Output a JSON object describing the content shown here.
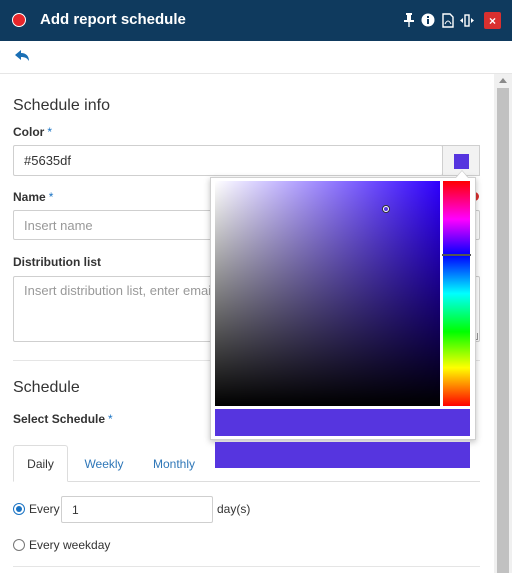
{
  "window": {
    "title": "Add report schedule",
    "icons": [
      "pin-icon",
      "info-icon",
      "pdf-icon",
      "resize-icon"
    ],
    "close_label": "×"
  },
  "colors": {
    "accent": "#5635df",
    "header_bg": "#0f3a5e",
    "link": "#2f77b8"
  },
  "schedule_info": {
    "title": "Schedule info",
    "color_label": "Color",
    "color_value": "#5635df",
    "name_label": "Name",
    "name_placeholder": "Insert name",
    "distribution_label": "Distribution list",
    "distribution_placeholder": "Insert distribution list, enter emails"
  },
  "schedule": {
    "title": "Schedule",
    "select_label": "Select Schedule",
    "required_mark": "*",
    "tabs": [
      {
        "label": "Daily",
        "active": true
      },
      {
        "label": "Weekly",
        "active": false
      },
      {
        "label": "Monthly",
        "active": false
      }
    ],
    "every_label": "Every",
    "every_value": "1",
    "every_unit": "day(s)",
    "every_weekday_label": "Every weekday"
  },
  "picker": {
    "hue_level": 0.33
  }
}
